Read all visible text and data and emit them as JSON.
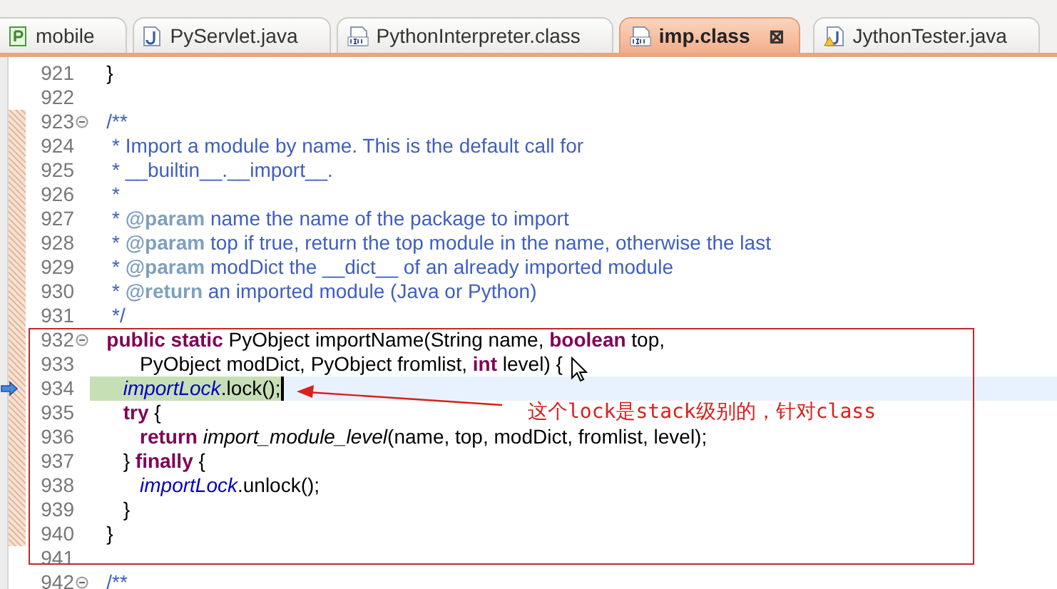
{
  "tabs": [
    {
      "label": "mobile",
      "kind": "project",
      "selected": false
    },
    {
      "label": "PyServlet.java",
      "kind": "java",
      "selected": false
    },
    {
      "label": "PythonInterpreter.class",
      "kind": "class",
      "selected": false
    },
    {
      "label": "imp.class",
      "kind": "class",
      "selected": true,
      "close": "⊠"
    },
    {
      "label": "JythonTester.java",
      "kind": "java-warning",
      "selected": false
    }
  ],
  "editor": {
    "lines": [
      {
        "number": "921",
        "fold": false,
        "changed": false,
        "current": false,
        "tokens": [
          {
            "text": "   }",
            "kind": "plain"
          }
        ]
      },
      {
        "number": "922",
        "fold": false,
        "changed": false,
        "current": false
      },
      {
        "number": "923",
        "fold": true,
        "changed": true,
        "current": false,
        "tokens": [
          {
            "text": "   /**",
            "kind": "comment"
          }
        ]
      },
      {
        "number": "924",
        "fold": false,
        "changed": true,
        "current": false,
        "tokens": [
          {
            "text": "    * Import a module by name. This is the default call for",
            "kind": "comment"
          }
        ]
      },
      {
        "number": "925",
        "fold": false,
        "changed": true,
        "current": false,
        "tokens": [
          {
            "text": "    * __builtin__.__import__.",
            "kind": "comment"
          }
        ]
      },
      {
        "number": "926",
        "fold": false,
        "changed": true,
        "current": false,
        "tokens": [
          {
            "text": "    *",
            "kind": "comment"
          }
        ]
      },
      {
        "number": "927",
        "fold": false,
        "changed": true,
        "current": false,
        "tokens": [
          {
            "text": "    * ",
            "kind": "comment"
          },
          {
            "text": "@param",
            "kind": "doctag"
          },
          {
            "text": " name the name of the package to import",
            "kind": "comment"
          }
        ]
      },
      {
        "number": "928",
        "fold": false,
        "changed": true,
        "current": false,
        "tokens": [
          {
            "text": "    * ",
            "kind": "comment"
          },
          {
            "text": "@param",
            "kind": "doctag"
          },
          {
            "text": " top if true, return the top module in the name, otherwise the last",
            "kind": "comment"
          }
        ]
      },
      {
        "number": "929",
        "fold": false,
        "changed": true,
        "current": false,
        "tokens": [
          {
            "text": "    * ",
            "kind": "comment"
          },
          {
            "text": "@param",
            "kind": "doctag"
          },
          {
            "text": " modDict the __dict__ of an already imported module",
            "kind": "comment"
          }
        ]
      },
      {
        "number": "930",
        "fold": false,
        "changed": true,
        "current": false,
        "tokens": [
          {
            "text": "    * ",
            "kind": "comment"
          },
          {
            "text": "@return",
            "kind": "doctag"
          },
          {
            "text": " an imported module (Java or Python)",
            "kind": "comment"
          }
        ]
      },
      {
        "number": "931",
        "fold": false,
        "changed": true,
        "current": false,
        "tokens": [
          {
            "text": "    */",
            "kind": "comment"
          }
        ]
      },
      {
        "number": "932",
        "fold": true,
        "changed": true,
        "current": false,
        "tokens": [
          {
            "text": "   public static",
            "kind": "keyword"
          },
          {
            "text": " PyObject importName(String name, ",
            "kind": "plain"
          },
          {
            "text": "boolean",
            "kind": "keyword"
          },
          {
            "text": " top,",
            "kind": "plain"
          }
        ]
      },
      {
        "number": "933",
        "fold": false,
        "changed": true,
        "current": false,
        "tokens": [
          {
            "text": "         PyObject modDict, PyObject fromlist, ",
            "kind": "plain"
          },
          {
            "text": "int",
            "kind": "keyword"
          },
          {
            "text": " level) {",
            "kind": "plain"
          }
        ]
      },
      {
        "number": "934",
        "fold": false,
        "changed": true,
        "current": true,
        "tokens": [
          {
            "text": "      importLock",
            "kind": "field"
          },
          {
            "text": ".lock();",
            "kind": "plain"
          }
        ]
      },
      {
        "number": "935",
        "fold": false,
        "changed": true,
        "current": false,
        "tokens": [
          {
            "text": "      try",
            "kind": "keyword"
          },
          {
            "text": " {",
            "kind": "plain"
          }
        ]
      },
      {
        "number": "936",
        "fold": false,
        "changed": true,
        "current": false,
        "tokens": [
          {
            "text": "         return ",
            "kind": "keyword"
          },
          {
            "text": "import_module_level",
            "kind": "method"
          },
          {
            "text": "(name, top, modDict, fromlist, level);",
            "kind": "plain"
          }
        ]
      },
      {
        "number": "937",
        "fold": false,
        "changed": true,
        "current": false,
        "tokens": [
          {
            "text": "      } ",
            "kind": "plain"
          },
          {
            "text": "finally",
            "kind": "keyword"
          },
          {
            "text": " {",
            "kind": "plain"
          }
        ]
      },
      {
        "number": "938",
        "fold": false,
        "changed": true,
        "current": false,
        "tokens": [
          {
            "text": "         importLock",
            "kind": "field"
          },
          {
            "text": ".unlock();",
            "kind": "plain"
          }
        ]
      },
      {
        "number": "939",
        "fold": false,
        "changed": true,
        "current": false,
        "tokens": [
          {
            "text": "      }",
            "kind": "plain"
          }
        ]
      },
      {
        "number": "940",
        "fold": false,
        "changed": true,
        "current": false,
        "tokens": [
          {
            "text": "   }",
            "kind": "plain"
          }
        ]
      },
      {
        "number": "941",
        "fold": false,
        "changed": false,
        "current": false
      },
      {
        "number": "942",
        "fold": true,
        "changed": false,
        "current": false,
        "tokens": [
          {
            "text": "   /**",
            "kind": "comment"
          }
        ]
      }
    ]
  },
  "annotation": {
    "text": "这个lock是stack级别的，针对class"
  }
}
